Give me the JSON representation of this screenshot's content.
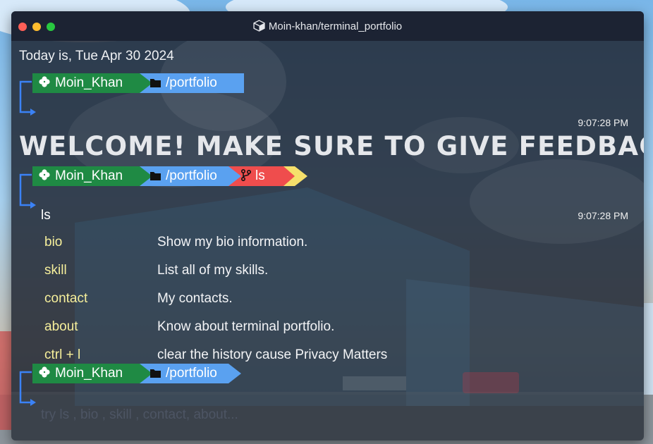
{
  "window": {
    "title": "Moin-khan/terminal_portfolio",
    "title_icon": "package-icon"
  },
  "colors": {
    "close": "#ff5f57",
    "minimize": "#febc2e",
    "maximize": "#28c840",
    "user_seg": "#1f8a44",
    "dir_seg": "#5aa1f0",
    "git_seg": "#ef4d4d",
    "git_tail": "#f5df6b",
    "bracket": "#3b82f6",
    "cmd_name": "#f6ef9b"
  },
  "date_line": "Today is, Tue Apr 30 2024",
  "prompt": {
    "user": "Moin_Khan",
    "dir": "/portfolio",
    "user_icon": "clover-icon",
    "dir_icon": "folder-icon",
    "git_icon": "git-branch-icon"
  },
  "entries": [
    {
      "time": "9:07:28 PM"
    },
    {
      "time": "9:07:28 PM",
      "git_label": "ls",
      "command": "ls"
    }
  ],
  "welcome": "WELCOME! MAKE SURE TO GIVE FEEDBACK",
  "commands": [
    {
      "name": "bio",
      "desc": "Show my bio information."
    },
    {
      "name": "skill",
      "desc": "List all of my skills."
    },
    {
      "name": "contact",
      "desc": "My contacts."
    },
    {
      "name": "about",
      "desc": "Know about terminal portfolio."
    },
    {
      "name": "ctrl + l",
      "desc": "clear the history cause Privacy Matters"
    }
  ],
  "input": {
    "value": "",
    "placeholder": "try ls , bio , skill , contact, about..."
  }
}
